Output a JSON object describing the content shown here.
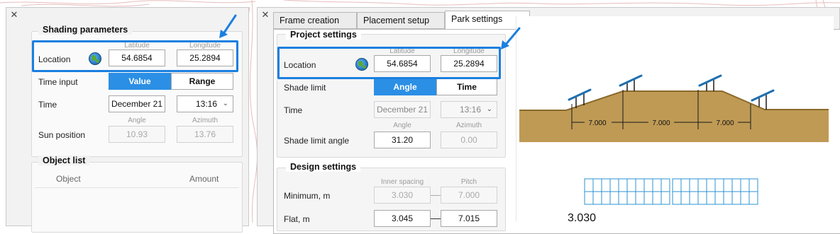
{
  "left": {
    "shading": {
      "title": "Shading parameters",
      "location_label": "Location",
      "lat_caption": "Latitude",
      "lon_caption": "Longitude",
      "latitude": "54.6854",
      "longitude": "25.2894",
      "time_input_label": "Time input",
      "time_input_options": [
        "Value",
        "Range"
      ],
      "time_input_selected": "Value",
      "time_label": "Time",
      "date": "December 21",
      "time": "13:16",
      "angle_caption": "Angle",
      "azimuth_caption": "Azimuth",
      "sun_position_label": "Sun position",
      "angle": "10.93",
      "azimuth": "13.76"
    },
    "object_list": {
      "title": "Object list",
      "col_object": "Object",
      "col_amount": "Amount"
    }
  },
  "right": {
    "tabs": [
      "Frame creation",
      "Placement setup",
      "Park settings"
    ],
    "active_tab": "Park settings",
    "project": {
      "title": "Project settings",
      "location_label": "Location",
      "lat_caption": "Latitude",
      "lon_caption": "Longitude",
      "latitude": "54.6854",
      "longitude": "25.2894",
      "shade_limit_label": "Shade limit",
      "shade_limit_options": [
        "Angle",
        "Time"
      ],
      "shade_limit_selected": "Angle",
      "time_label": "Time",
      "date": "December 21",
      "time": "13:16",
      "angle_caption": "Angle",
      "azimuth_caption": "Azimuth",
      "shade_limit_angle_label": "Shade limit angle",
      "angle": "31.20",
      "azimuth": "0.00"
    },
    "design": {
      "title": "Design settings",
      "inner_caption": "Inner spacing",
      "pitch_caption": "Pitch",
      "minimum_label": "Minimum, m",
      "minimum_inner": "3.030",
      "minimum_pitch": "7.000",
      "flat_label": "Flat, m",
      "flat_inner": "3.045",
      "flat_pitch": "7.015"
    },
    "diagram": {
      "spacings": [
        "7.000",
        "7.000",
        "7.000"
      ],
      "layout_value": "3.030"
    }
  },
  "colors": {
    "accent": "#2b8fe5",
    "highlight": "#1a7fe0",
    "terrain": "#bf9a55",
    "terrain_edge": "#8a6a2a",
    "panel": "#1e6fb0",
    "topo_lines": "#e2b0b0"
  }
}
